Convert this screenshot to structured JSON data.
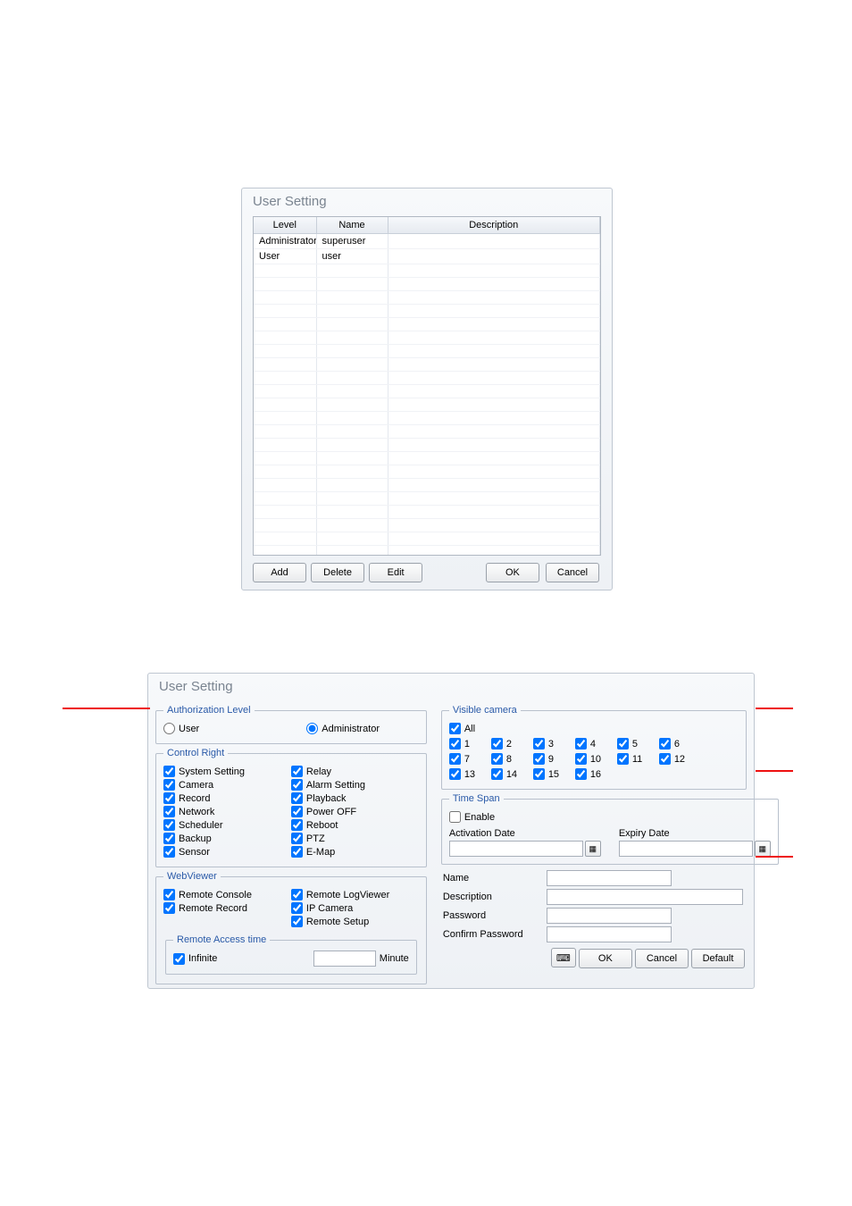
{
  "topPanel": {
    "title": "User Setting",
    "columns": {
      "level": "Level",
      "name": "Name",
      "description": "Description"
    },
    "rows": [
      {
        "level": "Administrator",
        "name": "superuser",
        "description": ""
      },
      {
        "level": "User",
        "name": "user",
        "description": ""
      }
    ],
    "buttons": {
      "add": "Add",
      "delete": "Delete",
      "edit": "Edit",
      "ok": "OK",
      "cancel": "Cancel"
    }
  },
  "bottomPanel": {
    "title": "User Setting",
    "authLevel": {
      "legend": "Authorization Level",
      "user": "User",
      "admin": "Administrator",
      "selected": "admin"
    },
    "controlRight": {
      "legend": "Control Right",
      "left": [
        "System Setting",
        "Camera",
        "Record",
        "Network",
        "Scheduler",
        "Backup",
        "Sensor"
      ],
      "right": [
        "Relay",
        "Alarm Setting",
        "Playback",
        "Power OFF",
        "Reboot",
        "PTZ",
        "E-Map"
      ]
    },
    "webViewer": {
      "legend": "WebViewer",
      "left": [
        "Remote Console",
        "Remote Record"
      ],
      "right": [
        "Remote LogViewer",
        "IP Camera",
        "Remote Setup"
      ],
      "remoteAccess": {
        "legend": "Remote Access time",
        "infinite": "Infinite",
        "minute": "Minute"
      }
    },
    "visibleCamera": {
      "legend": "Visible camera",
      "all": "All",
      "cams": [
        "1",
        "2",
        "3",
        "4",
        "5",
        "6",
        "7",
        "8",
        "9",
        "10",
        "11",
        "12",
        "13",
        "14",
        "15",
        "16"
      ]
    },
    "timeSpan": {
      "legend": "Time Span",
      "enable": "Enable",
      "activation": "Activation Date",
      "expiry": "Expiry Date"
    },
    "form": {
      "name": "Name",
      "description": "Description",
      "password": "Password",
      "confirm": "Confirm Password"
    },
    "buttons": {
      "ok": "OK",
      "cancel": "Cancel",
      "default": "Default"
    }
  }
}
